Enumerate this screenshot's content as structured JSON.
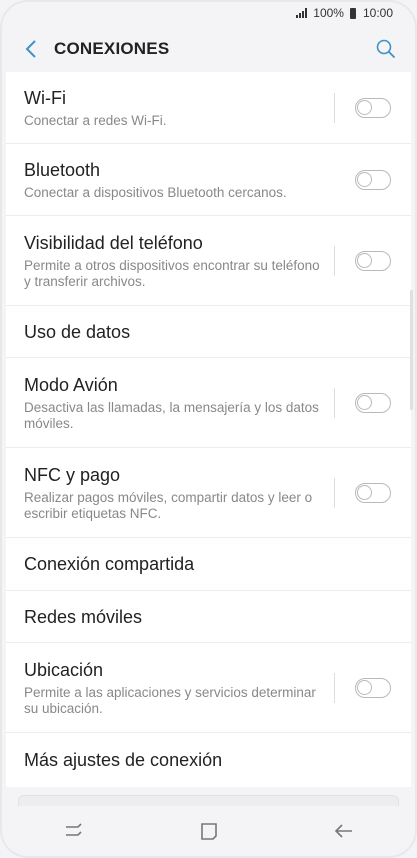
{
  "status_bar": {
    "battery": "100%",
    "time": "10:00"
  },
  "header": {
    "title": "CONEXIONES",
    "back_icon": "chevron-left-icon",
    "search_icon": "search-icon"
  },
  "colors": {
    "accent": "#3e91c9",
    "toggle_off": "#b9b9b9"
  },
  "items": [
    {
      "label": "Wi-Fi",
      "desc": "Conectar a redes Wi-Fi.",
      "toggle": false
    },
    {
      "label": "Bluetooth",
      "desc": "Conectar a dispositivos Bluetooth cercanos.",
      "toggle": false
    },
    {
      "label": "Visibilidad del teléfono",
      "desc": "Permite a otros dispositivos encontrar su teléfono y transferir archivos.",
      "toggle": false
    },
    {
      "label": "Uso de datos"
    },
    {
      "label": "Modo Avión",
      "desc": "Desactiva las llamadas, la mensajería y los datos móviles.",
      "toggle": false
    },
    {
      "label": "NFC y pago",
      "desc": "Realizar pagos móviles, compartir datos y leer o escribir etiquetas NFC.",
      "toggle": false
    },
    {
      "label": "Conexión compartida"
    },
    {
      "label": "Redes móviles"
    },
    {
      "label": "Ubicación",
      "desc": "Permite a las aplicaciones y servicios determinar su ubicación.",
      "toggle": false
    },
    {
      "label": "Más ajustes de conexión"
    }
  ],
  "nav_bar": {
    "recents_icon": "recents-icon",
    "home_icon": "home-icon",
    "back_icon": "back-arrow-icon"
  }
}
